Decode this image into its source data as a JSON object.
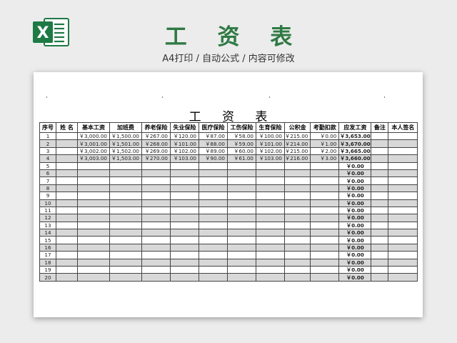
{
  "header": {
    "title": "工 资 表",
    "subtitle": "A4打印 / 自动公式 / 内容可修改"
  },
  "logo": {
    "icon": "excel-logo-icon",
    "letter": "X",
    "color": "#1e7a45"
  },
  "sheet": {
    "title": "工 资 表"
  },
  "table": {
    "columns": [
      "序号",
      "姓 名",
      "基本工资",
      "加班费",
      "养老保险",
      "失业保险",
      "医疗保险",
      "工伤保险",
      "生育保险",
      "公积金",
      "考勤扣款",
      "应发工资",
      "备注",
      "本人签名"
    ],
    "rows": [
      [
        "1",
        "",
        "￥3,000.00",
        "￥1,500.00",
        "￥267.00",
        "￥120.00",
        "￥87.00",
        "￥58.00",
        "￥100.00",
        "￥215.00",
        "￥0.00",
        "￥3,653.00",
        "",
        ""
      ],
      [
        "2",
        "",
        "￥3,001.00",
        "￥1,501.00",
        "￥268.00",
        "￥101.00",
        "￥88.00",
        "￥59.00",
        "￥101.00",
        "￥214.00",
        "￥1.00",
        "￥3,670.00",
        "",
        ""
      ],
      [
        "3",
        "",
        "￥3,002.00",
        "￥1,502.00",
        "￥269.00",
        "￥102.00",
        "￥89.00",
        "￥60.00",
        "￥102.00",
        "￥215.00",
        "￥2.00",
        "￥3,665.00",
        "",
        ""
      ],
      [
        "4",
        "",
        "￥3,003.00",
        "￥1,503.00",
        "￥270.00",
        "￥103.00",
        "￥90.00",
        "￥61.00",
        "￥103.00",
        "￥216.00",
        "￥3.00",
        "￥3,660.00",
        "",
        ""
      ],
      [
        "5",
        "",
        "",
        "",
        "",
        "",
        "",
        "",
        "",
        "",
        "",
        "￥0.00",
        "",
        ""
      ],
      [
        "6",
        "",
        "",
        "",
        "",
        "",
        "",
        "",
        "",
        "",
        "",
        "￥0.00",
        "",
        ""
      ],
      [
        "7",
        "",
        "",
        "",
        "",
        "",
        "",
        "",
        "",
        "",
        "",
        "￥0.00",
        "",
        ""
      ],
      [
        "8",
        "",
        "",
        "",
        "",
        "",
        "",
        "",
        "",
        "",
        "",
        "￥0.00",
        "",
        ""
      ],
      [
        "9",
        "",
        "",
        "",
        "",
        "",
        "",
        "",
        "",
        "",
        "",
        "￥0.00",
        "",
        ""
      ],
      [
        "10",
        "",
        "",
        "",
        "",
        "",
        "",
        "",
        "",
        "",
        "",
        "￥0.00",
        "",
        ""
      ],
      [
        "11",
        "",
        "",
        "",
        "",
        "",
        "",
        "",
        "",
        "",
        "",
        "￥0.00",
        "",
        ""
      ],
      [
        "12",
        "",
        "",
        "",
        "",
        "",
        "",
        "",
        "",
        "",
        "",
        "￥0.00",
        "",
        ""
      ],
      [
        "13",
        "",
        "",
        "",
        "",
        "",
        "",
        "",
        "",
        "",
        "",
        "￥0.00",
        "",
        ""
      ],
      [
        "14",
        "",
        "",
        "",
        "",
        "",
        "",
        "",
        "",
        "",
        "",
        "￥0.00",
        "",
        ""
      ],
      [
        "15",
        "",
        "",
        "",
        "",
        "",
        "",
        "",
        "",
        "",
        "",
        "￥0.00",
        "",
        ""
      ],
      [
        "16",
        "",
        "",
        "",
        "",
        "",
        "",
        "",
        "",
        "",
        "",
        "￥0.00",
        "",
        ""
      ],
      [
        "17",
        "",
        "",
        "",
        "",
        "",
        "",
        "",
        "",
        "",
        "",
        "￥0.00",
        "",
        ""
      ],
      [
        "18",
        "",
        "",
        "",
        "",
        "",
        "",
        "",
        "",
        "",
        "",
        "￥0.00",
        "",
        ""
      ],
      [
        "19",
        "",
        "",
        "",
        "",
        "",
        "",
        "",
        "",
        "",
        "",
        "￥0.00",
        "",
        ""
      ],
      [
        "20",
        "",
        "",
        "",
        "",
        "",
        "",
        "",
        "",
        "",
        "",
        "￥0.00",
        "",
        ""
      ]
    ]
  },
  "colors": {
    "title_green": "#2f7a44",
    "stripe_gray": "#d8d8d8",
    "background": "#ececec"
  }
}
